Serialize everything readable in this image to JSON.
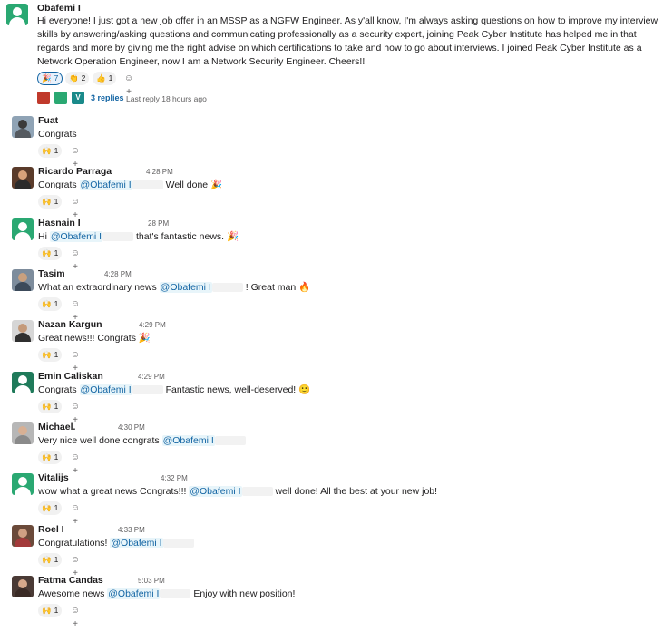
{
  "root": {
    "author": "Obafemi I",
    "text": "Hi everyone! I just got a new job offer in an MSSP as a NGFW Engineer. As y'all know, I'm always asking questions on how to improve my interview skills by answering/asking questions and communicating professionally as a security expert, joining Peak Cyber Institute has helped me in that regards and more by giving me the right advise on which certifications to take and how to go about interviews. I joined Peak Cyber Institute as a Network Operation Engineer, now I am a Network Security Engineer. Cheers!!",
    "reactions": [
      {
        "emoji": "🎉",
        "count": "7",
        "active": true
      },
      {
        "emoji": "👏",
        "count": "2",
        "active": false
      },
      {
        "emoji": "👍",
        "count": "1",
        "active": false
      }
    ],
    "replies_label": "3 replies",
    "last_reply": "Last reply 18 hours ago",
    "reply_avatar_letter": "V"
  },
  "messages": [
    {
      "author": "Fuat",
      "time": "",
      "pre": "Congrats",
      "mention": "",
      "post": "",
      "emoji": "",
      "count": "1"
    },
    {
      "author": "Ricardo Parraga",
      "time": "4:28 PM",
      "pre": "Congrats ",
      "mention": "@Obafemi I",
      "post": " Well done",
      "emoji": "🎉",
      "count": "1"
    },
    {
      "author": "Hasnain I",
      "time": "28 PM",
      "pre": "Hi ",
      "mention": "@Obafemi I",
      "post": " that's fantastic news.",
      "emoji": "🎉",
      "count": "1"
    },
    {
      "author": "Tasim",
      "time": "4:28 PM",
      "pre": "What an extraordinary news ",
      "mention": "@Obafemi I",
      "post": " ! Great man",
      "emoji": "🔥",
      "count": "1"
    },
    {
      "author": "Nazan Kargun",
      "time": "4:29 PM",
      "pre": "Great news!!! Congrats",
      "mention": "",
      "post": "",
      "emoji": "🎉",
      "count": "1"
    },
    {
      "author": "Emin Caliskan",
      "time": "4:29 PM",
      "pre": "Congrats ",
      "mention": "@Obafemi I",
      "post": " Fantastic news, well-deserved!",
      "emoji": "🙂",
      "count": "1"
    },
    {
      "author": "Michael.",
      "time": "4:30 PM",
      "pre": "Very nice well done congrats ",
      "mention": "@Obafemi I",
      "post": "",
      "emoji": "",
      "count": "1"
    },
    {
      "author": "Vitalijs",
      "time": "4:32 PM",
      "pre": "wow what a  great news Congrats!!! ",
      "mention": "@Obafemi I",
      "post": " well done! All the best at your new job!",
      "emoji": "",
      "count": "1"
    },
    {
      "author": "Roel I",
      "time": "4:33 PM",
      "pre": "Congratulations! ",
      "mention": "@Obafemi I",
      "post": "",
      "emoji": "",
      "count": "1"
    },
    {
      "author": "Fatma Candas",
      "time": "5:03 PM",
      "pre": "Awesome news ",
      "mention": "@Obafemi I",
      "post": " Enjoy with new position!",
      "emoji": "",
      "count": "1"
    }
  ],
  "reaction_emoji": "🙌",
  "add_reaction_glyph": "☺+",
  "colors": {
    "link": "#1264a3",
    "mention_bg": "#e8f5fa",
    "avatar_green": "#2aa872"
  }
}
